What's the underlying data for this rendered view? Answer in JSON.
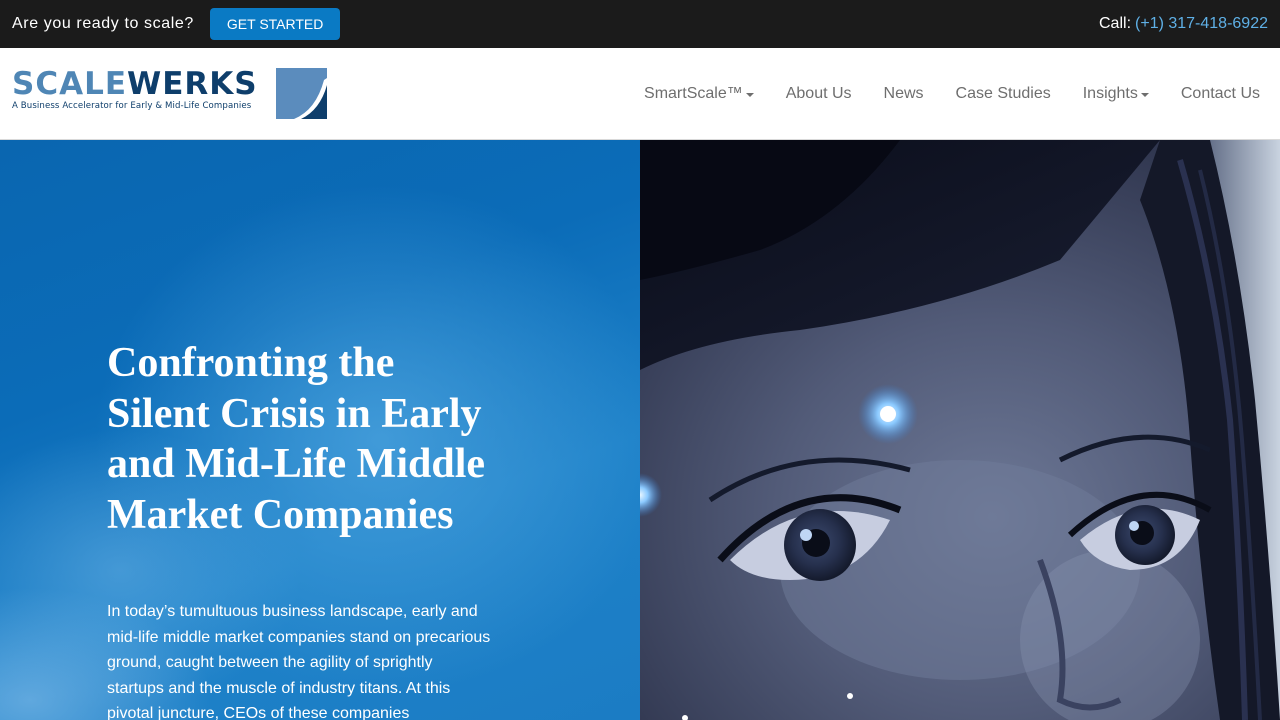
{
  "topbar": {
    "tagline": "Are you ready to scale?",
    "cta_label": "GET STARTED",
    "call_label": "Call:",
    "phone": "(+1) 317-418-6922"
  },
  "brand": {
    "wordmark_part1": "SCALE",
    "wordmark_part2": "WERKS",
    "tagline": "A Business Accelerator for Early & Mid-Life Companies",
    "colors": {
      "light_blue": "#4f86b5",
      "dark_blue": "#0e3e6b"
    }
  },
  "nav": {
    "items": [
      {
        "label": "SmartScale™",
        "dropdown": true
      },
      {
        "label": "About Us",
        "dropdown": false
      },
      {
        "label": "News",
        "dropdown": false
      },
      {
        "label": "Case Studies",
        "dropdown": false
      },
      {
        "label": "Insights",
        "dropdown": true
      },
      {
        "label": "Contact Us",
        "dropdown": false
      }
    ]
  },
  "hero": {
    "title": "Confronting the Silent Crisis in Early and Mid-Life Middle Market Companies",
    "body": "In today’s tumultuous business landscape, early and mid-life middle market companies stand on precarious ground, caught between the agility of sprightly startups and the muscle of industry titans. At this pivotal juncture, CEOs of these companies",
    "image_icon": "woman-face-photo"
  },
  "colors": {
    "topbar_bg": "#1b1b1b",
    "cta_bg": "#0a7ac4",
    "phone_link": "#5fb0e6",
    "hero_blue": "#0b6cb8",
    "nav_text": "#6e6e6e"
  }
}
